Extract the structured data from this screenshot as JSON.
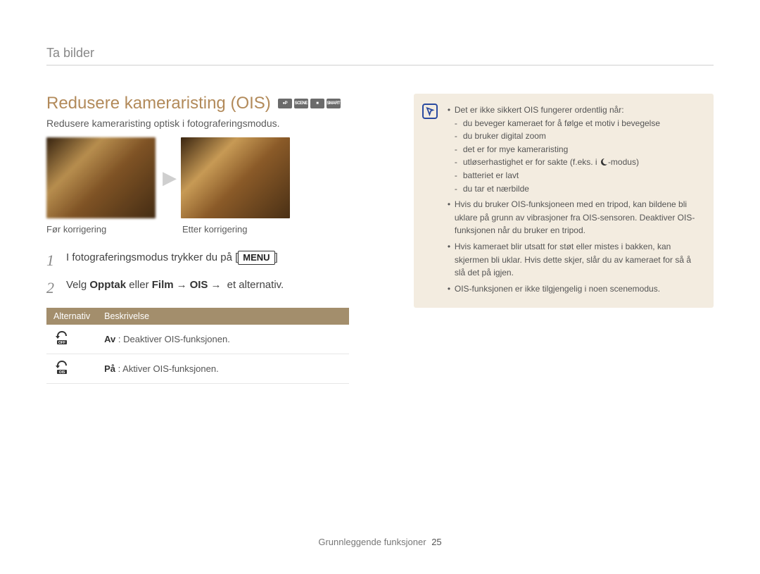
{
  "breadcrumb": "Ta bilder",
  "title": "Redusere kameraristing (OIS)",
  "subtitle": "Redusere kameraristing optisk i fotograferingsmodus.",
  "modeIconNames": [
    "camera-mode-icon",
    "scene-mode-icon",
    "video-mode-icon",
    "smart-mode-icon"
  ],
  "modeIconLabels": [
    "●P",
    "SCENE",
    "■",
    "SMART"
  ],
  "caption_before": "Før korrigering",
  "caption_after": "Etter korrigering",
  "step1_prefix": "I fotograferingsmodus trykker du på [",
  "step1_key": "MENU",
  "step1_suffix": "]",
  "step2_prefix": "Velg ",
  "step2_b1": "Opptak",
  "step2_mid1": " eller ",
  "step2_b2": "Film",
  "step2_arrow1": "→",
  "step2_b3": "OIS",
  "step2_arrow2": "→",
  "step2_tail": " et alternativ.",
  "table_headers": [
    "Alternativ",
    "Beskrivelse"
  ],
  "rows": [
    {
      "iconLabel": "OFF",
      "label": "Av",
      "desc": ": Deaktiver OIS-funksjonen."
    },
    {
      "iconLabel": "OIS",
      "label": "På",
      "desc": ": Aktiver OIS-funksjonen."
    }
  ],
  "note": {
    "b1": "Det er ikke sikkert OIS fungerer ordentlig når:",
    "subs": [
      "du beveger kameraet for å følge et motiv i bevegelse",
      "du bruker digital zoom",
      "det er for mye kameraristing",
      "utløserhastighet er for sakte (f.eks. i ",
      "-modus)",
      "batteriet er lavt",
      "du tar et nærbilde"
    ],
    "b2": "Hvis du bruker OIS-funksjoneen med en tripod, kan bildene bli uklare på grunn av vibrasjoner fra OIS-sensoren. Deaktiver OIS-funksjonen når du bruker en tripod.",
    "b3": "Hvis kameraet blir utsatt for støt eller mistes i bakken, kan skjermen bli uklar. Hvis dette skjer, slår du av kameraet for så å slå det på igjen.",
    "b4": "OIS-funksjonen er ikke tilgjengelig i noen scenemodus."
  },
  "footer": "Grunnleggende funksjoner",
  "pageNumber": "25"
}
